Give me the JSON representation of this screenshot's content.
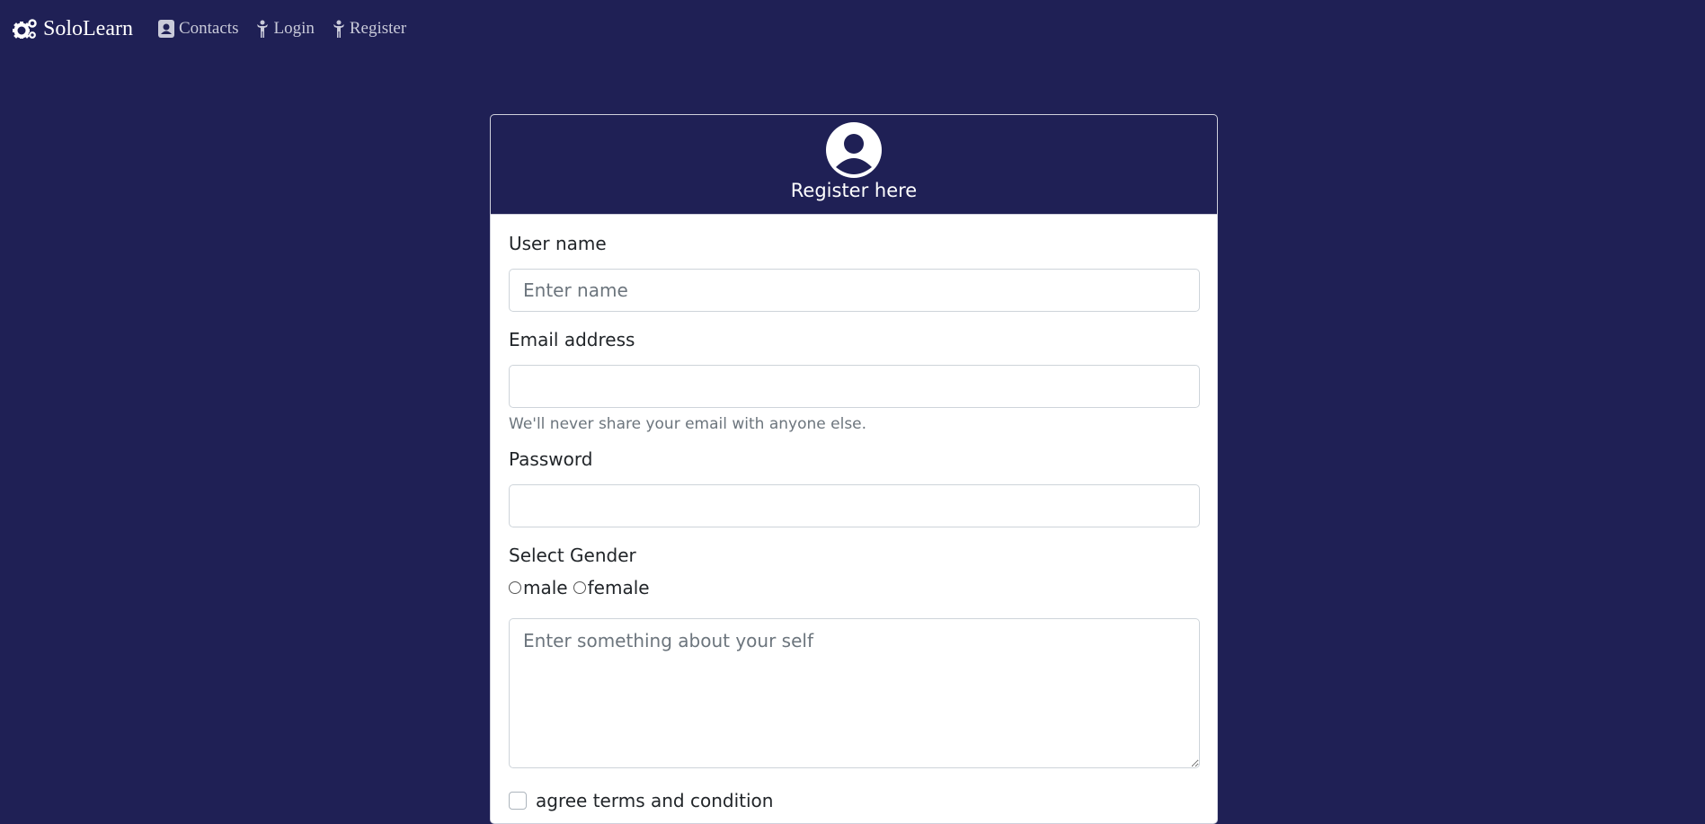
{
  "nav": {
    "brand": "SoloLearn",
    "items": [
      {
        "label": "Contacts",
        "icon": "contact-card-icon"
      },
      {
        "label": "Login",
        "icon": "person-icon"
      },
      {
        "label": "Register",
        "icon": "person-icon"
      }
    ]
  },
  "form": {
    "header_title": "Register here",
    "username": {
      "label": "User name",
      "placeholder": "Enter name",
      "value": ""
    },
    "email": {
      "label": "Email address",
      "placeholder": "",
      "value": "",
      "help": "We'll never share your email with anyone else."
    },
    "password": {
      "label": "Password",
      "placeholder": "",
      "value": ""
    },
    "gender": {
      "label": "Select Gender",
      "options": [
        "male",
        "female"
      ]
    },
    "about": {
      "placeholder": "Enter something about your self",
      "value": ""
    },
    "terms": {
      "label": "agree terms and condition"
    }
  },
  "colors": {
    "background": "#1f2055",
    "card": "#ffffff"
  }
}
